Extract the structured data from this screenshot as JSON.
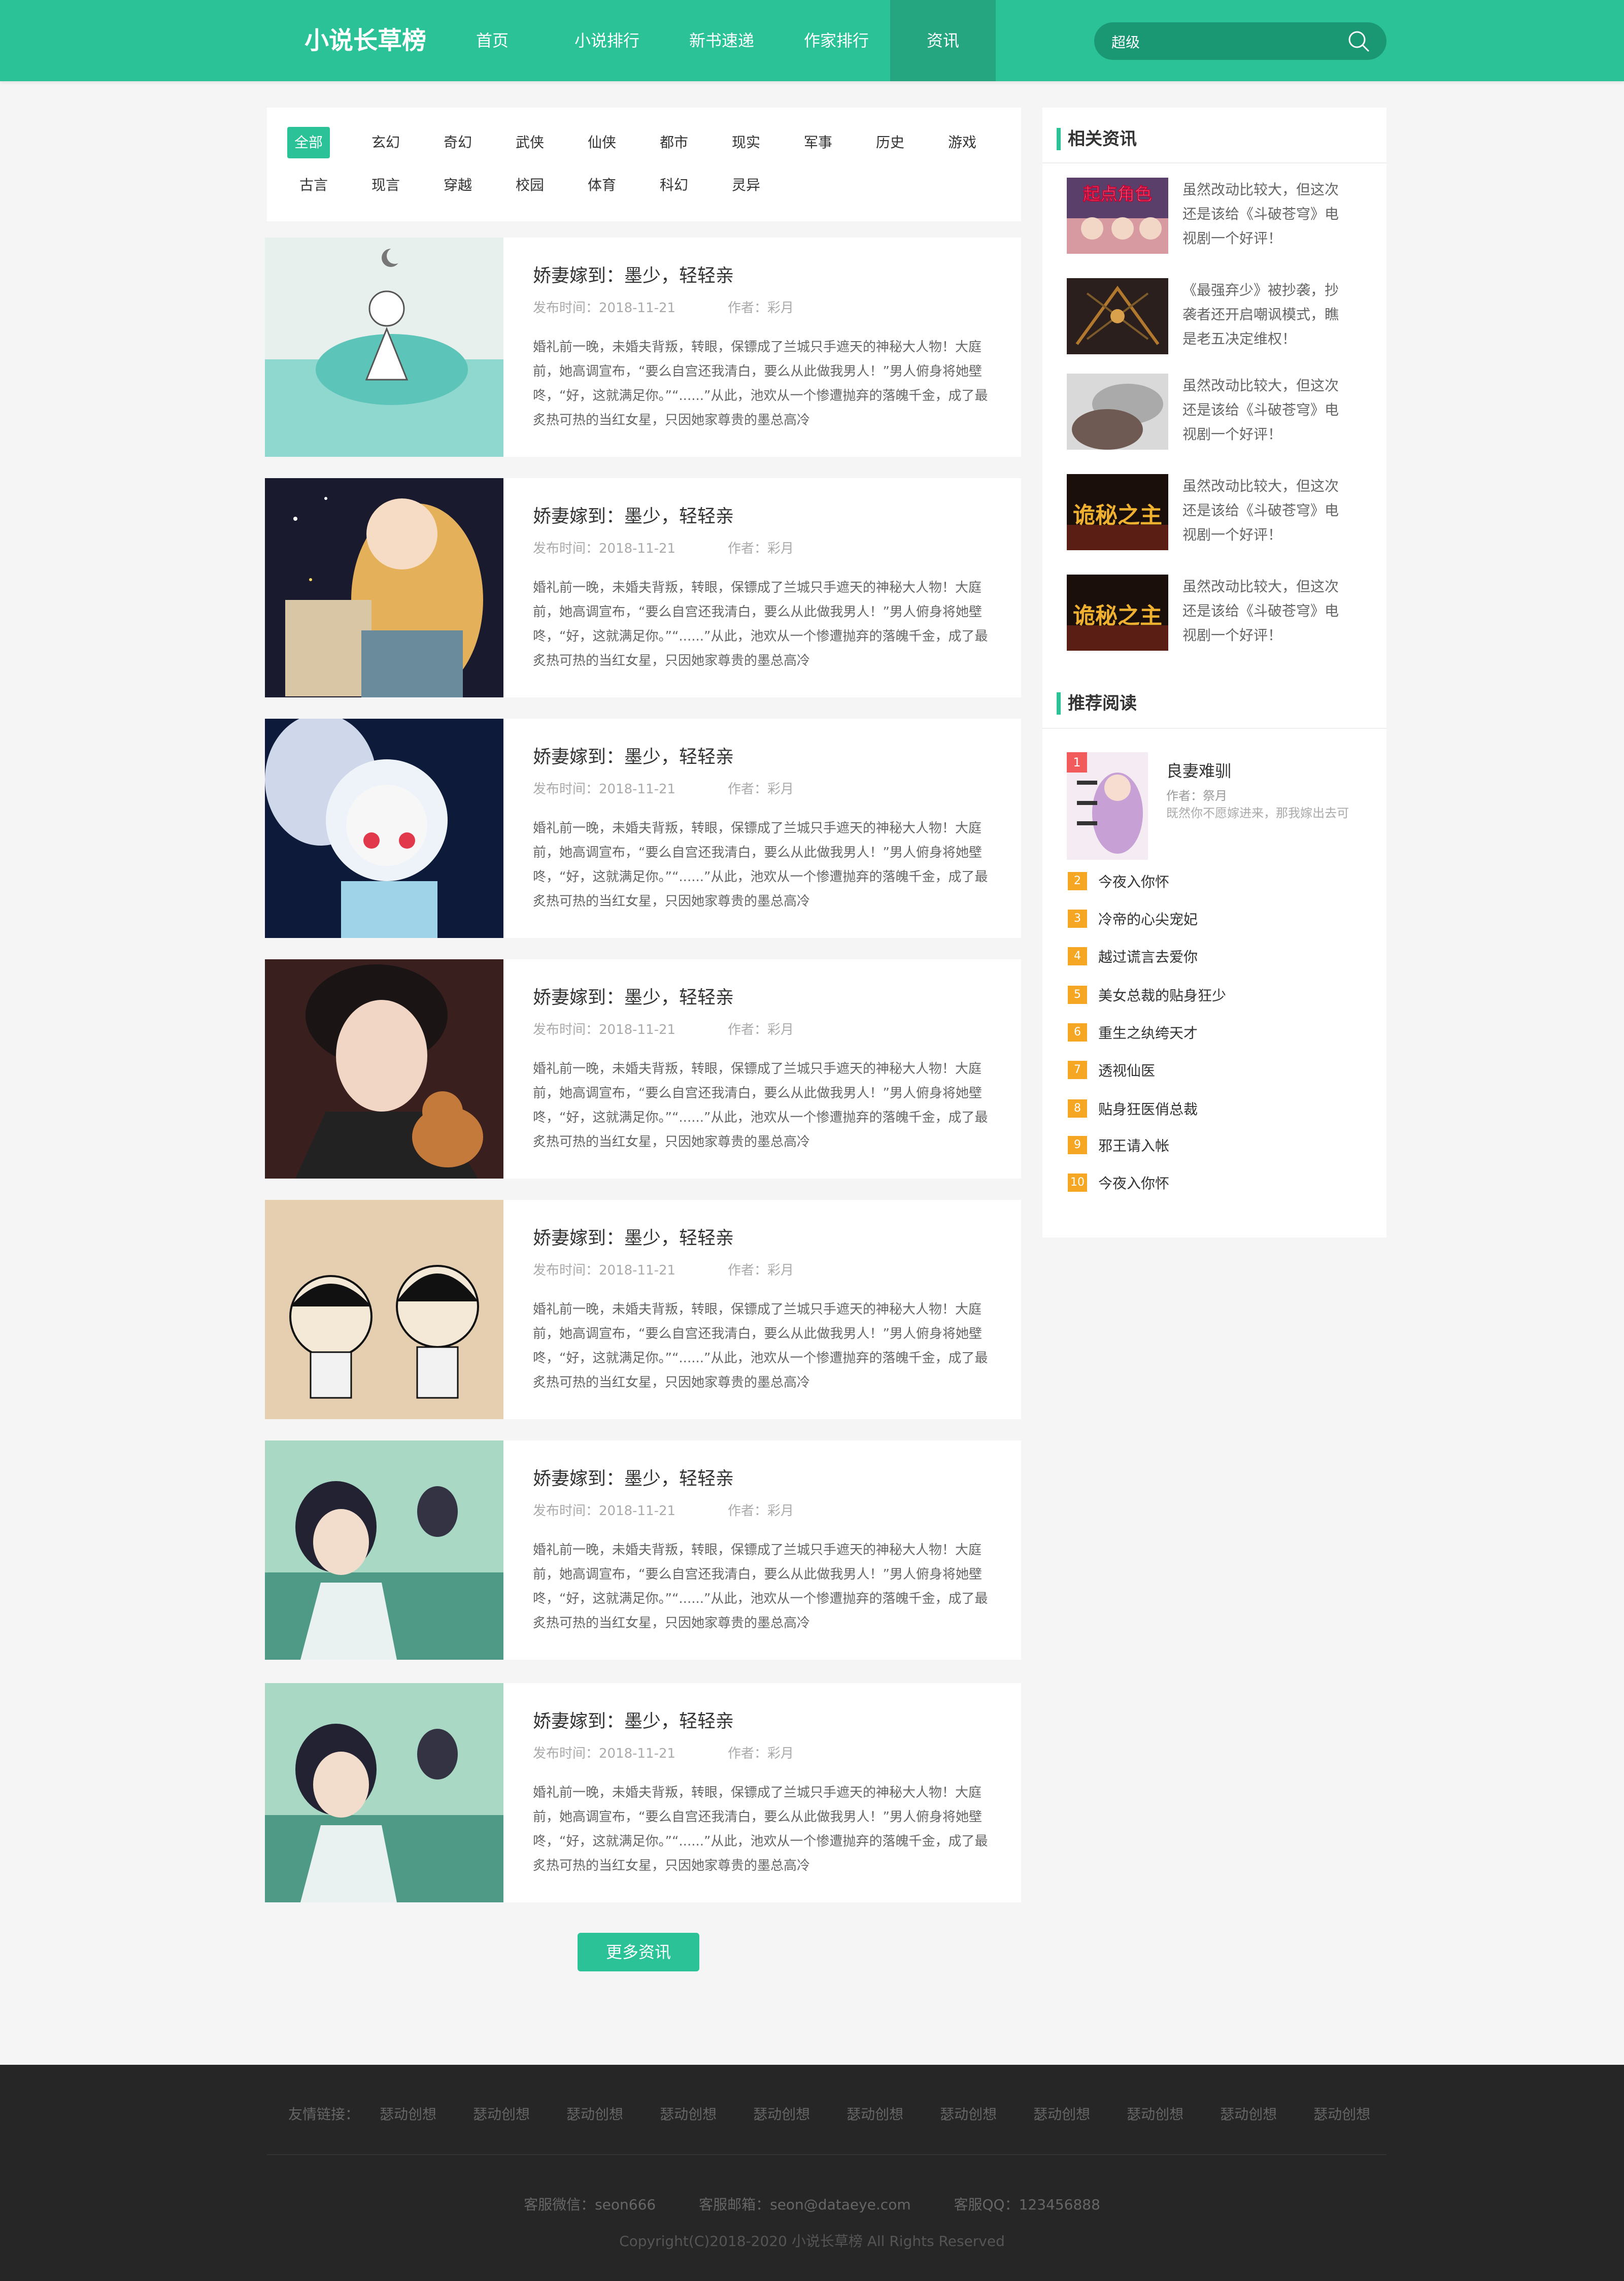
{
  "site": {
    "logo": "小说长草榜"
  },
  "nav": [
    {
      "label": "首页"
    },
    {
      "label": "小说排行"
    },
    {
      "label": "新书速递"
    },
    {
      "label": "作家排行"
    },
    {
      "label": "资讯",
      "active": true
    }
  ],
  "search": {
    "value": "超级",
    "icon": "search-icon"
  },
  "filters": {
    "row1": [
      "全部",
      "玄幻",
      "奇幻",
      "武侠",
      "仙侠",
      "都市",
      "现实",
      "军事",
      "历史",
      "游戏"
    ],
    "row2": [
      "古言",
      "现言",
      "穿越",
      "校园",
      "体育",
      "科幻",
      "灵异"
    ],
    "active": "全部"
  },
  "articles": [
    {
      "title": "娇妻嫁到：墨少，轻轻亲",
      "date": "发布时间：2018-11-21",
      "author": "作者：彩月",
      "text": "婚礼前一晚，未婚夫背叛，转眼，保镖成了兰城只手遮天的神秘大人物！大庭前，她高调宣布，“要么自宫还我清白，要么从此做我男人！”男人俯身将她壁咚，“好，这就满足你。”“......”从此，池欢从一个惨遭抛弃的落魄千金，成了最炙热可热的当红女星，只因她家尊贵的墨总高冷"
    },
    {
      "title": "娇妻嫁到：墨少，轻轻亲",
      "date": "发布时间：2018-11-21",
      "author": "作者：彩月",
      "text": "婚礼前一晚，未婚夫背叛，转眼，保镖成了兰城只手遮天的神秘大人物！大庭前，她高调宣布，“要么自宫还我清白，要么从此做我男人！”男人俯身将她壁咚，“好，这就满足你。”“......”从此，池欢从一个惨遭抛弃的落魄千金，成了最炙热可热的当红女星，只因她家尊贵的墨总高冷"
    },
    {
      "title": "娇妻嫁到：墨少，轻轻亲",
      "date": "发布时间：2018-11-21",
      "author": "作者：彩月",
      "text": "婚礼前一晚，未婚夫背叛，转眼，保镖成了兰城只手遮天的神秘大人物！大庭前，她高调宣布，“要么自宫还我清白，要么从此做我男人！”男人俯身将她壁咚，“好，这就满足你。”“......”从此，池欢从一个惨遭抛弃的落魄千金，成了最炙热可热的当红女星，只因她家尊贵的墨总高冷"
    },
    {
      "title": "娇妻嫁到：墨少，轻轻亲",
      "date": "发布时间：2018-11-21",
      "author": "作者：彩月",
      "text": "婚礼前一晚，未婚夫背叛，转眼，保镖成了兰城只手遮天的神秘大人物！大庭前，她高调宣布，“要么自宫还我清白，要么从此做我男人！”男人俯身将她壁咚，“好，这就满足你。”“......”从此，池欢从一个惨遭抛弃的落魄千金，成了最炙热可热的当红女星，只因她家尊贵的墨总高冷"
    },
    {
      "title": "娇妻嫁到：墨少，轻轻亲",
      "date": "发布时间：2018-11-21",
      "author": "作者：彩月",
      "text": "婚礼前一晚，未婚夫背叛，转眼，保镖成了兰城只手遮天的神秘大人物！大庭前，她高调宣布，“要么自宫还我清白，要么从此做我男人！”男人俯身将她壁咚，“好，这就满足你。”“......”从此，池欢从一个惨遭抛弃的落魄千金，成了最炙热可热的当红女星，只因她家尊贵的墨总高冷"
    },
    {
      "title": "娇妻嫁到：墨少，轻轻亲",
      "date": "发布时间：2018-11-21",
      "author": "作者：彩月",
      "text": "婚礼前一晚，未婚夫背叛，转眼，保镖成了兰城只手遮天的神秘大人物！大庭前，她高调宣布，“要么自宫还我清白，要么从此做我男人！”男人俯身将她壁咚，“好，这就满足你。”“......”从此，池欢从一个惨遭抛弃的落魄千金，成了最炙热可热的当红女星，只因她家尊贵的墨总高冷"
    },
    {
      "title": "娇妻嫁到：墨少，轻轻亲",
      "date": "发布时间：2018-11-21",
      "author": "作者：彩月",
      "text": "婚礼前一晚，未婚夫背叛，转眼，保镖成了兰城只手遮天的神秘大人物！大庭前，她高调宣布，“要么自宫还我清白，要么从此做我男人！”男人俯身将她壁咚，“好，这就满足你。”“......”从此，池欢从一个惨遭抛弃的落魄千金，成了最炙热可热的当红女星，只因她家尊贵的墨总高冷"
    }
  ],
  "more_button": "更多资讯",
  "sidebar": {
    "related_title": "相关资讯",
    "related": [
      {
        "thumb_text": "起点角色",
        "text": "虽然改动比较大，但这次还是该给《斗破苍穹》电视剧一个好评！"
      },
      {
        "thumb_text": "",
        "text": "《最强弃少》被抄袭，抄袭者还开启嘲讽模式，瞧是老五决定维权！"
      },
      {
        "thumb_text": "",
        "text": "虽然改动比较大，但这次还是该给《斗破苍穹》电视剧一个好评！"
      },
      {
        "thumb_text": "诡秘之主",
        "text": "虽然改动比较大，但这次还是该给《斗破苍穹》电视剧一个好评！"
      },
      {
        "thumb_text": "诡秘之主",
        "text": "虽然改动比较大，但这次还是该给《斗破苍穹》电视剧一个好评！"
      }
    ],
    "recommend_title": "推荐阅读",
    "top_book": {
      "num": "1",
      "title": "良妻难驯",
      "author": "作者：祭月",
      "desc": "既然你不愿嫁进来，那我嫁出去可"
    },
    "ranks": [
      {
        "num": "2",
        "title": "今夜入你怀"
      },
      {
        "num": "3",
        "title": "冷帝的心尖宠妃"
      },
      {
        "num": "4",
        "title": "越过谎言去爱你"
      },
      {
        "num": "5",
        "title": "美女总裁的贴身狂少"
      },
      {
        "num": "6",
        "title": "重生之纨绔天才"
      },
      {
        "num": "7",
        "title": "透视仙医"
      },
      {
        "num": "8",
        "title": "贴身狂医俏总裁"
      },
      {
        "num": "9",
        "title": "邪王请入帐"
      },
      {
        "num": "10",
        "title": "今夜入你怀"
      }
    ]
  },
  "footer": {
    "links_label": "友情链接：",
    "links": [
      "瑟动创想",
      "瑟动创想",
      "瑟动创想",
      "瑟动创想",
      "瑟动创想",
      "瑟动创想",
      "瑟动创想",
      "瑟动创想",
      "瑟动创想",
      "瑟动创想",
      "瑟动创想"
    ],
    "wechat": "客服微信：seon666",
    "email": "客服邮箱：seon@dataeye.com",
    "qq": "客服QQ：123456888",
    "copyright": "Copyright(C)2018-2020 小说长草榜 All Rights Reserved"
  },
  "colors": {
    "brand": "#2bc297",
    "brand_dark": "#25a681",
    "rank_orange": "#f5a623",
    "rank_red": "#f15b5b"
  }
}
